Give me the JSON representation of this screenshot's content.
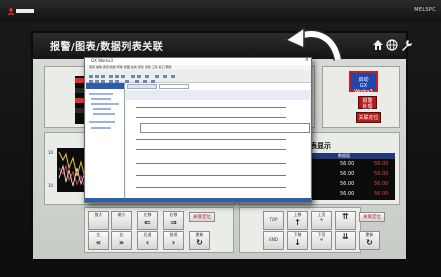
{
  "header": {
    "brand_mark": "MITSUBISHI",
    "title": "报警/图表/数据列表关联",
    "right_logo": "MELSPC"
  },
  "right_buttons": {
    "gxworks": "启动\nGX Works3",
    "alarm": "报警\n处理",
    "blue_line2": "GX Works3",
    "blue_line1": "启动",
    "red_mid_line1": "报警",
    "red_mid_line2": "处理",
    "red_bottom": "关联定位"
  },
  "data_panel": {
    "title": "数据表显示",
    "header_col1": "数据值",
    "header_col2": "",
    "rows": [
      {
        "left": "10",
        "v1": "56.00",
        "v2": "56.00"
      },
      {
        "left": "10",
        "v1": "56.00",
        "v2": "56.00"
      },
      {
        "left": "10",
        "v1": "56.00",
        "v2": "56.00"
      },
      {
        "left": "10",
        "v1": "56.00",
        "v2": "56.00"
      }
    ]
  },
  "chart_panel": {
    "axis_top": "10",
    "axis_bottom": "10"
  },
  "left_controls": {
    "row1": [
      "放大",
      "缩小",
      "左移",
      "右移",
      "关联定位"
    ],
    "row2": [
      "左",
      "右",
      "后退",
      "前进",
      "更新"
    ]
  },
  "right_controls": {
    "row1": [
      "TOP",
      "上移",
      "上页",
      "",
      "关联定位"
    ],
    "row2": [
      "END",
      "下移",
      "下页",
      "",
      "更新"
    ]
  },
  "window": {
    "title": "GX Works3",
    "menu": "项目 编辑 搜索/替换 转换 视图 在线 调试 诊断 工具 窗口 帮助"
  },
  "colors": {
    "header_bg": "#1d1d1f",
    "panel_bg": "#e9ece7",
    "alarm_red": "#b51a1a",
    "gxworks_blue": "#2047a8",
    "value_red": "#e04040",
    "value_green": "#38d038"
  }
}
